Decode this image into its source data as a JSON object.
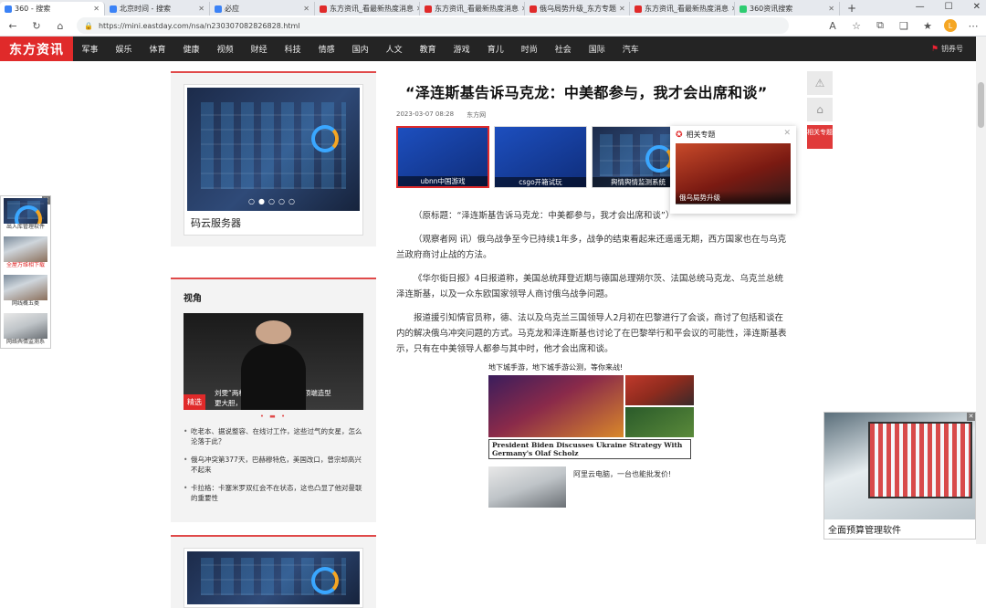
{
  "browser": {
    "tabs": [
      {
        "title": "360 - 搜索",
        "fav": "#3b82f6",
        "active": true
      },
      {
        "title": "北京时间 - 搜索",
        "fav": "#3b82f6"
      },
      {
        "title": "必应",
        "fav": "#3b82f6"
      },
      {
        "title": "东方资讯_看最新热度消息",
        "fav": "#e02a2a"
      },
      {
        "title": "东方资讯_看最新热度消息",
        "fav": "#e02a2a"
      },
      {
        "title": "俄乌局势升级_东方专题",
        "fav": "#e02a2a"
      },
      {
        "title": "东方资讯_看最新热度消息",
        "fav": "#e02a2a"
      },
      {
        "title": "360资讯搜索",
        "fav": "#2ecc71"
      }
    ],
    "url": "https://mini.eastday.com/nsa/n230307082826828.html",
    "avatar_letter": "L"
  },
  "site": {
    "logo": "东方资讯",
    "nav": [
      "军事",
      "娱乐",
      "体育",
      "健康",
      "视频",
      "财经",
      "科技",
      "情感",
      "国内",
      "人文",
      "教育",
      "游戏",
      "育儿",
      "时尚",
      "社会",
      "国际",
      "汽车"
    ],
    "user_label": "钥券号"
  },
  "left": {
    "ad_label": "码云服务器",
    "section_title": "视角",
    "featured_tag": "精选",
    "featured_caption": "刘雯“两根带条过膝”惹争议，顶端造型更大胆，用手挡脸防走光",
    "list": [
      "吃老本、据说整容、在线讨工作，这些过气的女星，怎么沦落于此？",
      "俄乌冲突第377天，巴赫穆特危，美国改口，曾宗却高兴不起来",
      "卡拉格：卡塞米罗双红会不在状态，这也凸显了他对曼联的重要性"
    ]
  },
  "article": {
    "title": "“泽连斯基告诉马克龙：中美都参与，我才会出席和谈”",
    "date": "2023-03-07 08:28",
    "source": "东方网",
    "thumbs": [
      "ubnn中国游戏",
      "csgo开箱试玩",
      "舆情舆情监测系统",
      ""
    ],
    "paragraphs": [
      "（原标题：“泽连斯基告诉马克龙：中美都参与，我才会出席和谈”）",
      "（观察者网 讯）俄乌战争至今已持续1年多，战争的结束看起来还遥遥无期，西方国家也在与乌克兰政府商讨止战的方法。",
      "《华尔街日报》4日报道称，美国总统拜登近期与德国总理朔尔茨、法国总统马克龙、乌克兰总统泽连斯基，以及一众东欧国家领导人商讨俄乌战争问题。",
      "报道援引知情官员称，德、法以及乌克兰三国领导人2月初在巴黎进行了会谈，商讨了包括和谈在内的解决俄乌冲突问题的方式。马克龙和泽连斯基也讨论了在巴黎举行和平会议的可能性，泽连斯基表示，只有在中美领导人都参与其中时，他才会出席和谈。"
    ],
    "ad_title": "地下城手游，地下城手游公测，等你来战!",
    "ad_banner": "President Biden Discusses Ukraine Strategy With Germany's Olaf Scholz",
    "ad2_text": "阿里云电脑，一台也能批发价!"
  },
  "topic_popup": {
    "header": "相关专题",
    "caption": "俄乌局势升级"
  },
  "tools": {
    "topic_btn": "相关专题"
  },
  "leftfloat": [
    {
      "label": "出入库管理软件",
      "red": false
    },
    {
      "label": "全屋万维相下载",
      "red": true
    },
    {
      "label": "网线概五类",
      "red": false
    },
    {
      "label": "网络舆情监测系",
      "red": false
    }
  ],
  "rightad": {
    "label": "全面预算管理软件"
  }
}
